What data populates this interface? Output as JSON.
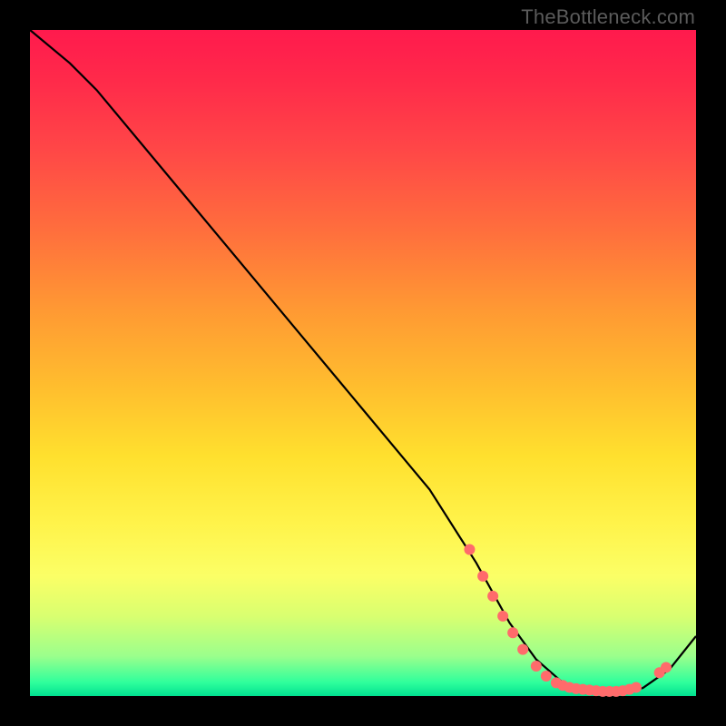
{
  "watermark": "TheBottleneck.com",
  "chart_data": {
    "type": "line",
    "title": "",
    "xlabel": "",
    "ylabel": "",
    "xlim": [
      0,
      100
    ],
    "ylim": [
      0,
      100
    ],
    "series": [
      {
        "name": "curve",
        "x": [
          0,
          6,
          10,
          20,
          30,
          40,
          50,
          60,
          67,
          72,
          76,
          80,
          84,
          88,
          92,
          96,
          100
        ],
        "y": [
          100,
          95,
          91,
          79,
          67,
          55,
          43,
          31,
          20,
          11,
          5.5,
          2,
          0.8,
          0.6,
          1.2,
          4,
          9
        ]
      }
    ],
    "markers": [
      {
        "x": 66,
        "y": 22
      },
      {
        "x": 68,
        "y": 18
      },
      {
        "x": 69.5,
        "y": 15
      },
      {
        "x": 71,
        "y": 12
      },
      {
        "x": 72.5,
        "y": 9.5
      },
      {
        "x": 74,
        "y": 7
      },
      {
        "x": 76,
        "y": 4.5
      },
      {
        "x": 77.5,
        "y": 3
      },
      {
        "x": 79,
        "y": 2
      },
      {
        "x": 80,
        "y": 1.6
      },
      {
        "x": 81,
        "y": 1.3
      },
      {
        "x": 82,
        "y": 1.1
      },
      {
        "x": 83,
        "y": 1.0
      },
      {
        "x": 84,
        "y": 0.9
      },
      {
        "x": 85,
        "y": 0.8
      },
      {
        "x": 86,
        "y": 0.7
      },
      {
        "x": 87,
        "y": 0.7
      },
      {
        "x": 88,
        "y": 0.7
      },
      {
        "x": 89,
        "y": 0.8
      },
      {
        "x": 90,
        "y": 1.0
      },
      {
        "x": 91,
        "y": 1.3
      },
      {
        "x": 94.5,
        "y": 3.5
      },
      {
        "x": 95.5,
        "y": 4.3
      }
    ],
    "colors": {
      "curve_stroke": "#000000",
      "marker_fill": "#ff6b6b"
    }
  }
}
